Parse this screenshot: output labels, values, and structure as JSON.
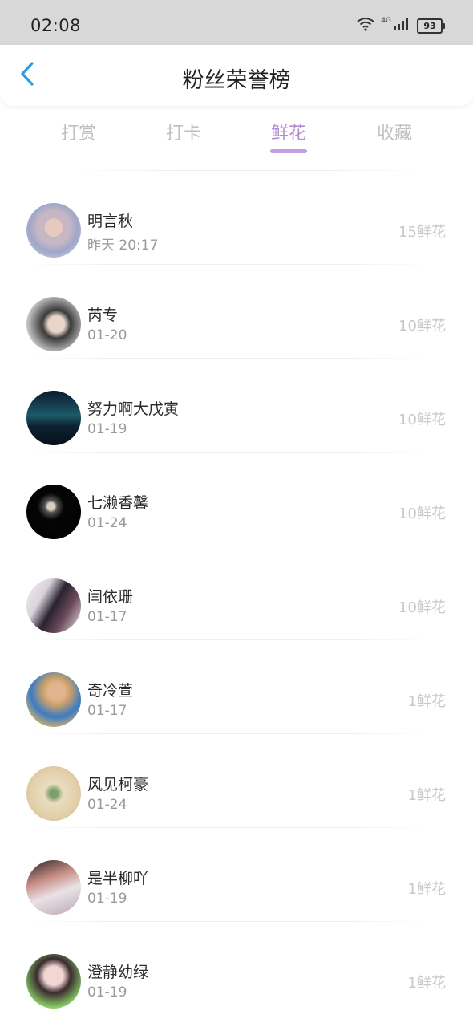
{
  "status_bar": {
    "time": "02:08",
    "network_label": "4G",
    "battery": "93"
  },
  "header": {
    "title": "粉丝荣誉榜",
    "back_icon": "chevron-left-icon"
  },
  "colors": {
    "accent": "#b48bd0",
    "indicator": "#c49de0",
    "back_icon": "#2a9de0",
    "inactive_tab": "#c0c0c0"
  },
  "tabs": [
    {
      "label": "打赏",
      "active": false
    },
    {
      "label": "打卡",
      "active": false
    },
    {
      "label": "鲜花",
      "active": true
    },
    {
      "label": "收藏",
      "active": false
    }
  ],
  "fans": [
    {
      "name": "明言秋",
      "time": "昨天 20:17",
      "amount": "15鲜花"
    },
    {
      "name": "芮专",
      "time": "01-20",
      "amount": "10鲜花"
    },
    {
      "name": "努力啊大戊寅",
      "time": "01-19",
      "amount": "10鲜花"
    },
    {
      "name": "七濑香馨",
      "time": "01-24",
      "amount": "10鲜花"
    },
    {
      "name": "闫依珊",
      "time": "01-17",
      "amount": "10鲜花"
    },
    {
      "name": "奇冷萱",
      "time": "01-17",
      "amount": "1鲜花"
    },
    {
      "name": "风见柯豪",
      "time": "01-24",
      "amount": "1鲜花"
    },
    {
      "name": "是半柳吖",
      "time": "01-19",
      "amount": "1鲜花"
    },
    {
      "name": "澄静幼绿",
      "time": "01-19",
      "amount": "1鲜花"
    }
  ]
}
